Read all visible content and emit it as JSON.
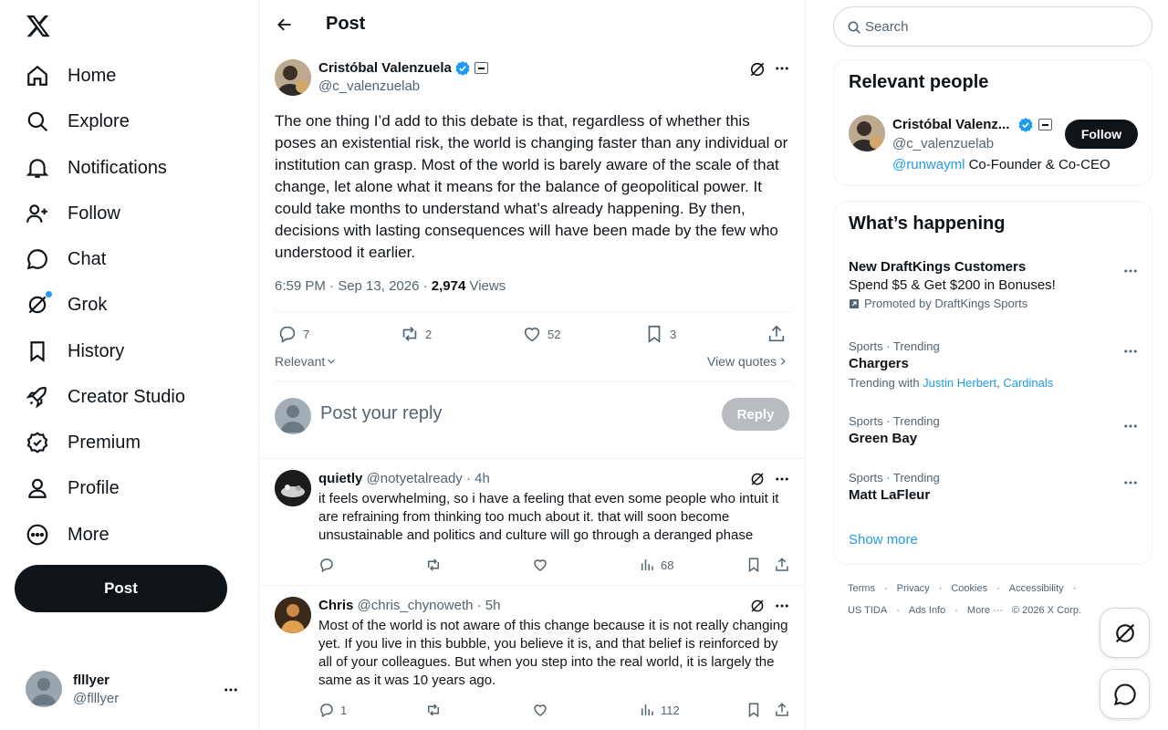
{
  "nav": {
    "items": [
      {
        "label": "Home",
        "icon": "home-icon"
      },
      {
        "label": "Explore",
        "icon": "search-icon"
      },
      {
        "label": "Notifications",
        "icon": "bell-icon"
      },
      {
        "label": "Follow",
        "icon": "add-user-icon"
      },
      {
        "label": "Chat",
        "icon": "chat-icon"
      },
      {
        "label": "Grok",
        "icon": "grok-icon"
      },
      {
        "label": "History",
        "icon": "bookmark-icon"
      },
      {
        "label": "Creator Studio",
        "icon": "rocket-icon"
      },
      {
        "label": "Premium",
        "icon": "verified-badge-icon"
      },
      {
        "label": "Profile",
        "icon": "person-icon"
      },
      {
        "label": "More",
        "icon": "more-circle-icon"
      }
    ],
    "post_label": "Post",
    "account": {
      "name": "flllyer",
      "handle": "@flllyer"
    }
  },
  "header": {
    "title": "Post"
  },
  "post": {
    "author": "Cristóbal Valenzuela",
    "handle": "@c_valenzuelab",
    "text": "The one thing I’d add to this debate is that, regardless of whether this poses an existential risk, the world is changing faster than any individual or institution can grasp. Most of the world is barely aware of the scale of that change, let alone what it means for the balance of geopolitical power. It could take months to understand what’s already happening. By then, decisions with lasting consequences will have been made by the few who understood it earlier.",
    "time": "6:59 PM · Sep 13, 2026 · ",
    "views": "2,974",
    "views_label": " Views",
    "replies": "7",
    "reposts": "2",
    "likes": "52",
    "bookmarks": "3",
    "sort_label": "Relevant",
    "view_quotes_label": "View quotes"
  },
  "composer": {
    "placeholder": "Post your reply",
    "reply_label": "Reply"
  },
  "replies": [
    {
      "name": "quietly",
      "handle": "@notyetalready",
      "time": " · 4h",
      "text": "it feels overwhelming, so i have a feeling that even some people who intuit it are refraining from thinking too much about it. that will soon become unsustainable and politics and culture will go through a deranged phase",
      "reply_count": "",
      "views": "68"
    },
    {
      "name": "Chris",
      "handle": "@chris_chynoweth",
      "time": " · 5h",
      "text": "Most of the world is not aware of this change because it is not really changing yet. If you live in this bubble, you believe it is, and that belief is reinforced by all of your colleagues. But when you step into the real world, it is largely the same as it was 10 years ago.",
      "reply_count": "1",
      "views": "112"
    }
  ],
  "search": {
    "placeholder": "Search"
  },
  "relevant": {
    "title": "Relevant people",
    "name": "Cristóbal Valenz...",
    "handle": "@c_valenzuelab",
    "bio_link": "@runwayml",
    "bio_rest": " Co-Founder & Co-CEO",
    "follow_label": "Follow"
  },
  "happening": {
    "title": "What’s happening",
    "promo": {
      "title": "New DraftKings Customers",
      "sub": "Spend $5 & Get $200 in Bonuses!",
      "promoted": "Promoted by DraftKings Sports"
    },
    "trends": [
      {
        "context": "Sports · Trending",
        "title": "Chargers",
        "with_label": "Trending with ",
        "with1": "Justin Herbert",
        "comma": ", ",
        "with2": "Cardinals"
      },
      {
        "context": "Sports · Trending",
        "title": "Green Bay"
      },
      {
        "context": "Sports · Trending",
        "title": "Matt LaFleur"
      }
    ],
    "show_more": "Show more"
  },
  "footer": {
    "row1": [
      "Terms",
      "·",
      "Privacy",
      "·",
      "Cookies",
      "·",
      "Accessibility",
      "·"
    ],
    "row2": [
      "US TIDA",
      "·",
      "Ads Info",
      "·",
      "More ···",
      "© 2026 X Corp."
    ]
  },
  "colors": {
    "accent": "#1d9bf0",
    "text": "#0f1419",
    "muted": "#536471"
  }
}
